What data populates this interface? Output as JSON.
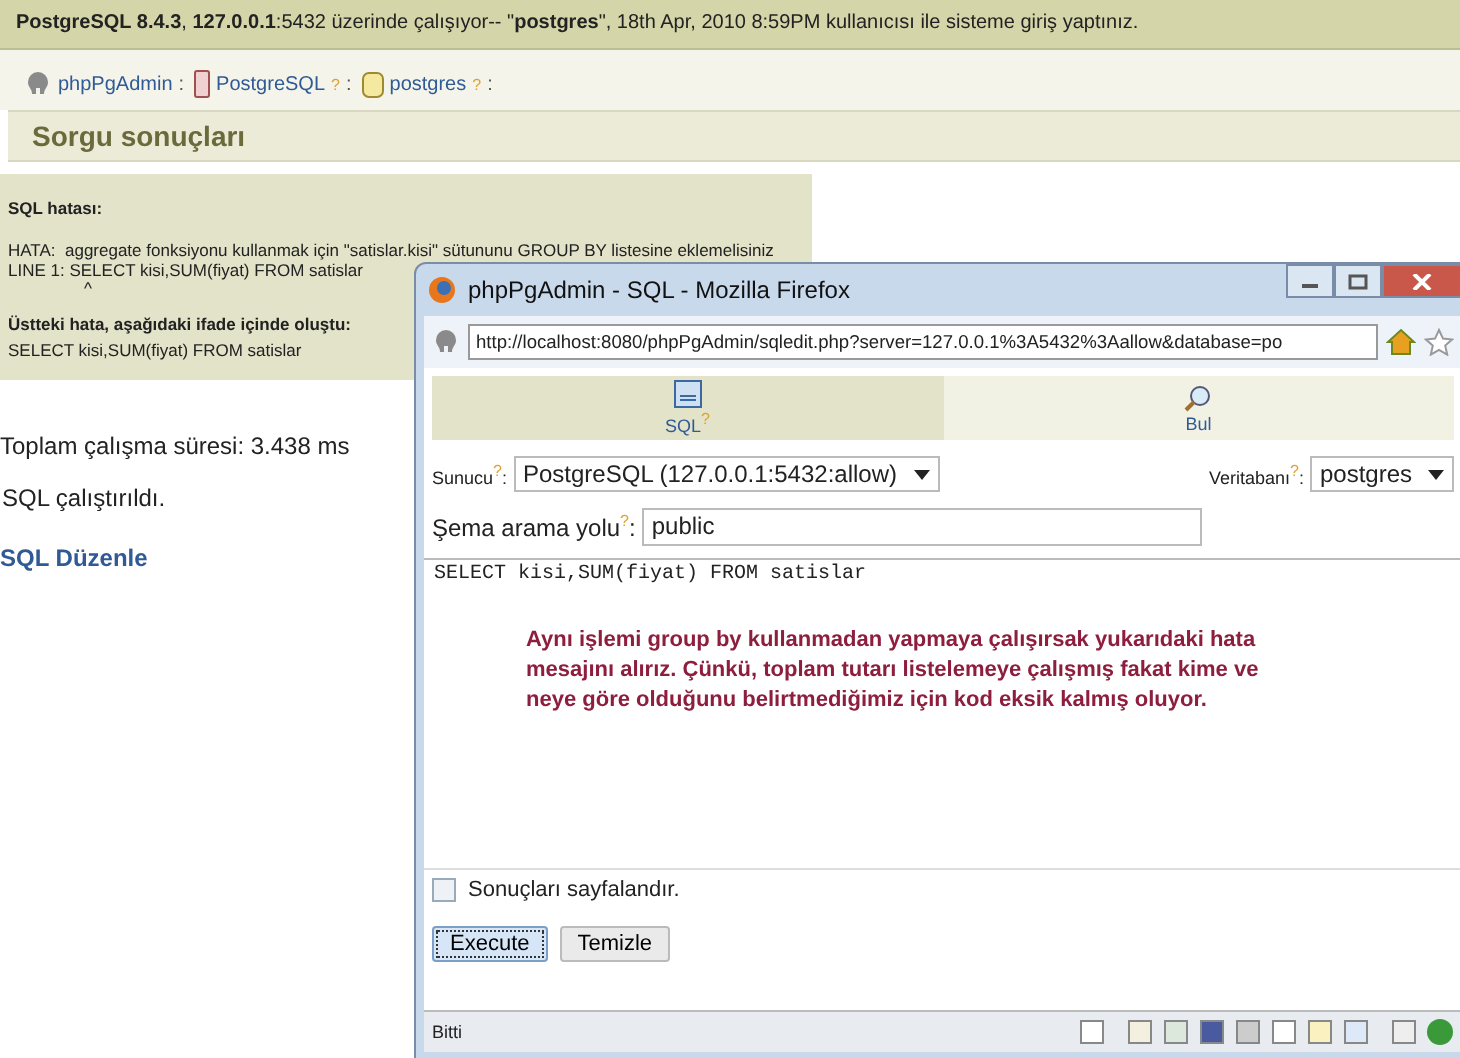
{
  "top_bar": {
    "text": "**PostgreSQL 8.4.3**, **127.0.0.1**:5432 üzerinde çalışıyor-- \"**postgres**\", 18th Apr, 2010 8:59PM kullanıcısı ile sisteme giriş yaptınız."
  },
  "breadcrumb": [
    {
      "label": "phpPgAdmin",
      "kind": "app"
    },
    {
      "label": "PostgreSQL",
      "kind": "server",
      "help": "?"
    },
    {
      "label": "postgres",
      "kind": "database",
      "help": "?"
    }
  ],
  "breadcrumb_separator": ":",
  "page_title": "Sorgu sonuçları",
  "error": {
    "heading": "SQL hatası:",
    "lines": [
      "HATA:  aggregate fonksiyonu kullanmak için \"satislar.kisi\" sütununu GROUP BY listesine eklemelisiniz",
      "LINE 1: SELECT kisi,SUM(fiyat) FROM satislar"
    ],
    "caret": "^",
    "context_heading": "Üstteki hata, aşağıdaki ifade içinde oluştu:",
    "context_sql": "SELECT kisi,SUM(fiyat) FROM satislar"
  },
  "total_time": "Toplam çalışma süresi: 3.438 ms",
  "status": "SQL çalıştırıldı.",
  "edit_link": "SQL Düzenle",
  "popup": {
    "title": "phpPgAdmin - SQL - Mozilla Firefox",
    "url": "http://localhost:8080/phpPgAdmin/sqledit.php?server=127.0.0.1%3A5432%3Aallow&database=po",
    "tabs": [
      {
        "label": "SQL",
        "kind": "sql",
        "help": "?",
        "selected": true
      },
      {
        "label": "Bul",
        "kind": "find",
        "selected": false
      }
    ],
    "server": {
      "label": "Sunucu",
      "help": "?",
      "suffix": ":",
      "value": "PostgreSQL (127.0.0.1:5432:allow)"
    },
    "database": {
      "label": "Veritabanı",
      "help": "?",
      "suffix": ":",
      "value": "postgres"
    },
    "schema": {
      "label": "Şema arama yolu",
      "help": "?",
      "suffix": ":",
      "value": "public"
    },
    "sql_text": "SELECT kisi,SUM(fiyat) FROM satislar",
    "note": "Aynı işlemi group by kullanmadan yapmaya çalışırsak yukarıdaki hata mesajını alırız. Çünkü, toplam tutarı listelemeye çalışmış fakat kime ve neye göre olduğunu belirtmediğimiz için kod eksik kalmış oluyor.",
    "paginate": {
      "label": "Sonuçları sayfalandır.",
      "checked": false
    },
    "buttons": [
      {
        "label": "Execute",
        "focused": true
      },
      {
        "label": "Temizle",
        "focused": false
      }
    ],
    "status_bar": "Bitti"
  }
}
